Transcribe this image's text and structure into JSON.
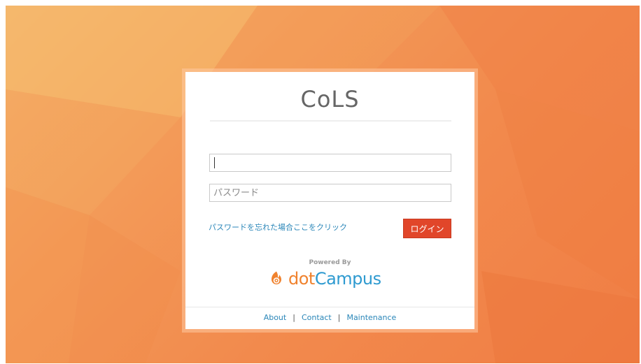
{
  "app": {
    "title": "CoLS"
  },
  "login_form": {
    "user_id": {
      "value": "",
      "placeholder": ""
    },
    "password": {
      "value": "",
      "placeholder": "パスワード"
    },
    "forgot_password_link": "パスワードを忘れた場合ここをクリック",
    "login_button": "ログイン"
  },
  "branding": {
    "powered_by": "Powered By",
    "logo_prefix": "dot",
    "logo_suffix": "Campus",
    "logo_icon": "dotcampus-flame-icon",
    "colors": {
      "logo_blue": "#2e9ad0",
      "logo_orange": "#f0822e"
    }
  },
  "footer": {
    "links": [
      "About",
      "Contact",
      "Maintenance"
    ],
    "separator": "|"
  },
  "theme": {
    "background": "#f28a4d",
    "button": "#e1462a",
    "link": "#2a86b8"
  }
}
